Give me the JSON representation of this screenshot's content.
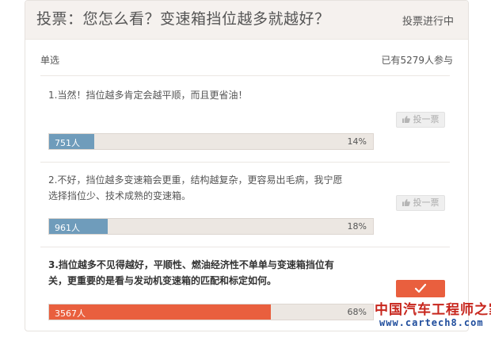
{
  "poll": {
    "title": "投票：您怎么看？变速箱挡位越多就越好？",
    "status": "投票进行中",
    "mode": "单选",
    "participants": "已有5279人参与"
  },
  "options": [
    {
      "text_lines": [
        "1.当然！挡位越多肯定会越平顺，而且更省油！"
      ],
      "count": "751人",
      "percent_label": "14%",
      "percent": 14,
      "bar_color": "#6f9cbb",
      "button_label": "投一票",
      "selected": false
    },
    {
      "text_lines": [
        "2.不好，挡位越多变速箱会更重，结构越复杂，更容易出毛病，我宁愿",
        "选择挡位少、技术成熟的变速箱。"
      ],
      "count": "961人",
      "percent_label": "18%",
      "percent": 18,
      "bar_color": "#6f9cbb",
      "button_label": "投一票",
      "selected": false
    },
    {
      "text_lines": [
        "3.挡位越多不见得越好，平顺性、燃油经济性不单单与变速箱挡位有",
        "关，更重要的是看与发动机变速箱的匹配和标定如何。"
      ],
      "count": "3567人",
      "percent_label": "68%",
      "percent": 68,
      "bar_color": "#e95f3e",
      "button_label": "",
      "selected": true
    }
  ],
  "watermark": {
    "cn": "中国汽车工程师之家",
    "en": "www.cartech8.com"
  },
  "colors": {
    "accent": "#e95f3e",
    "bar_blue": "#6f9cbb",
    "header_bg": "#f5f1ee"
  },
  "icons": {
    "vote": "thumbs-up-icon",
    "selected": "checkmark-icon"
  }
}
